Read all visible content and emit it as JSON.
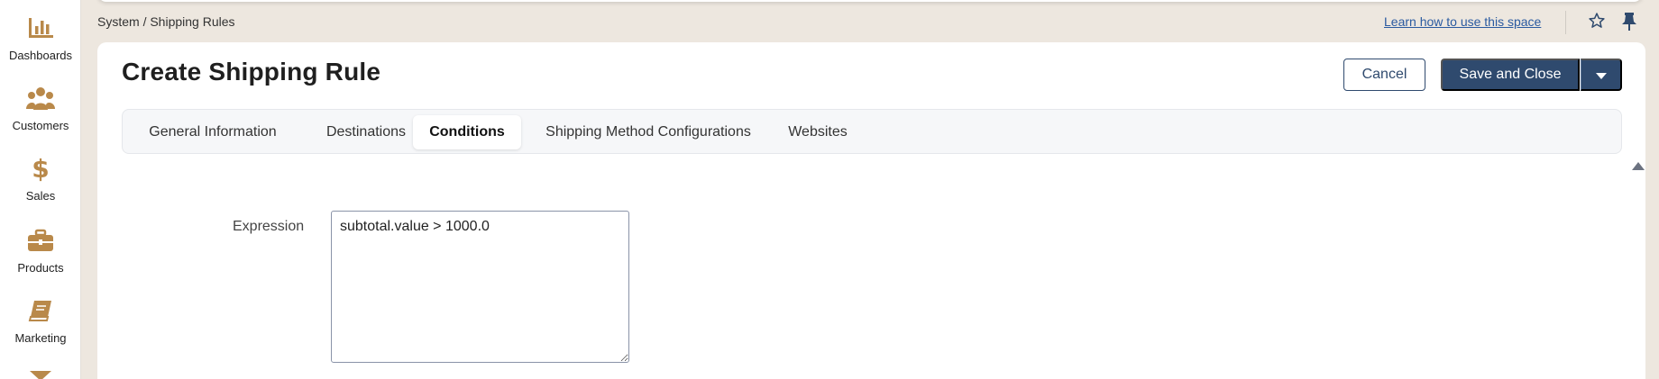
{
  "sidebar": {
    "items": [
      {
        "label": "Dashboards",
        "icon": "bar-chart-icon"
      },
      {
        "label": "Customers",
        "icon": "users-icon"
      },
      {
        "label": "Sales",
        "icon": "dollar-icon"
      },
      {
        "label": "Products",
        "icon": "briefcase-icon"
      },
      {
        "label": "Marketing",
        "icon": "book-icon"
      }
    ],
    "more_icon": "chevron-down-icon",
    "icon_color": "#b9894a"
  },
  "header": {
    "breadcrumb": "System / Shipping Rules",
    "help_link": "Learn how to use this space"
  },
  "page": {
    "title": "Create Shipping Rule",
    "cancel_label": "Cancel",
    "save_label": "Save and Close",
    "accent_color": "#2f4a6e"
  },
  "tabs": [
    {
      "label": "General Information",
      "active": false
    },
    {
      "label": "Destinations",
      "active": false
    },
    {
      "label": "Conditions",
      "active": true
    },
    {
      "label": "Shipping Method Configurations",
      "active": false
    },
    {
      "label": "Websites",
      "active": false
    }
  ],
  "form": {
    "expression_label": "Expression",
    "expression_value": "subtotal.value > 1000.0"
  }
}
